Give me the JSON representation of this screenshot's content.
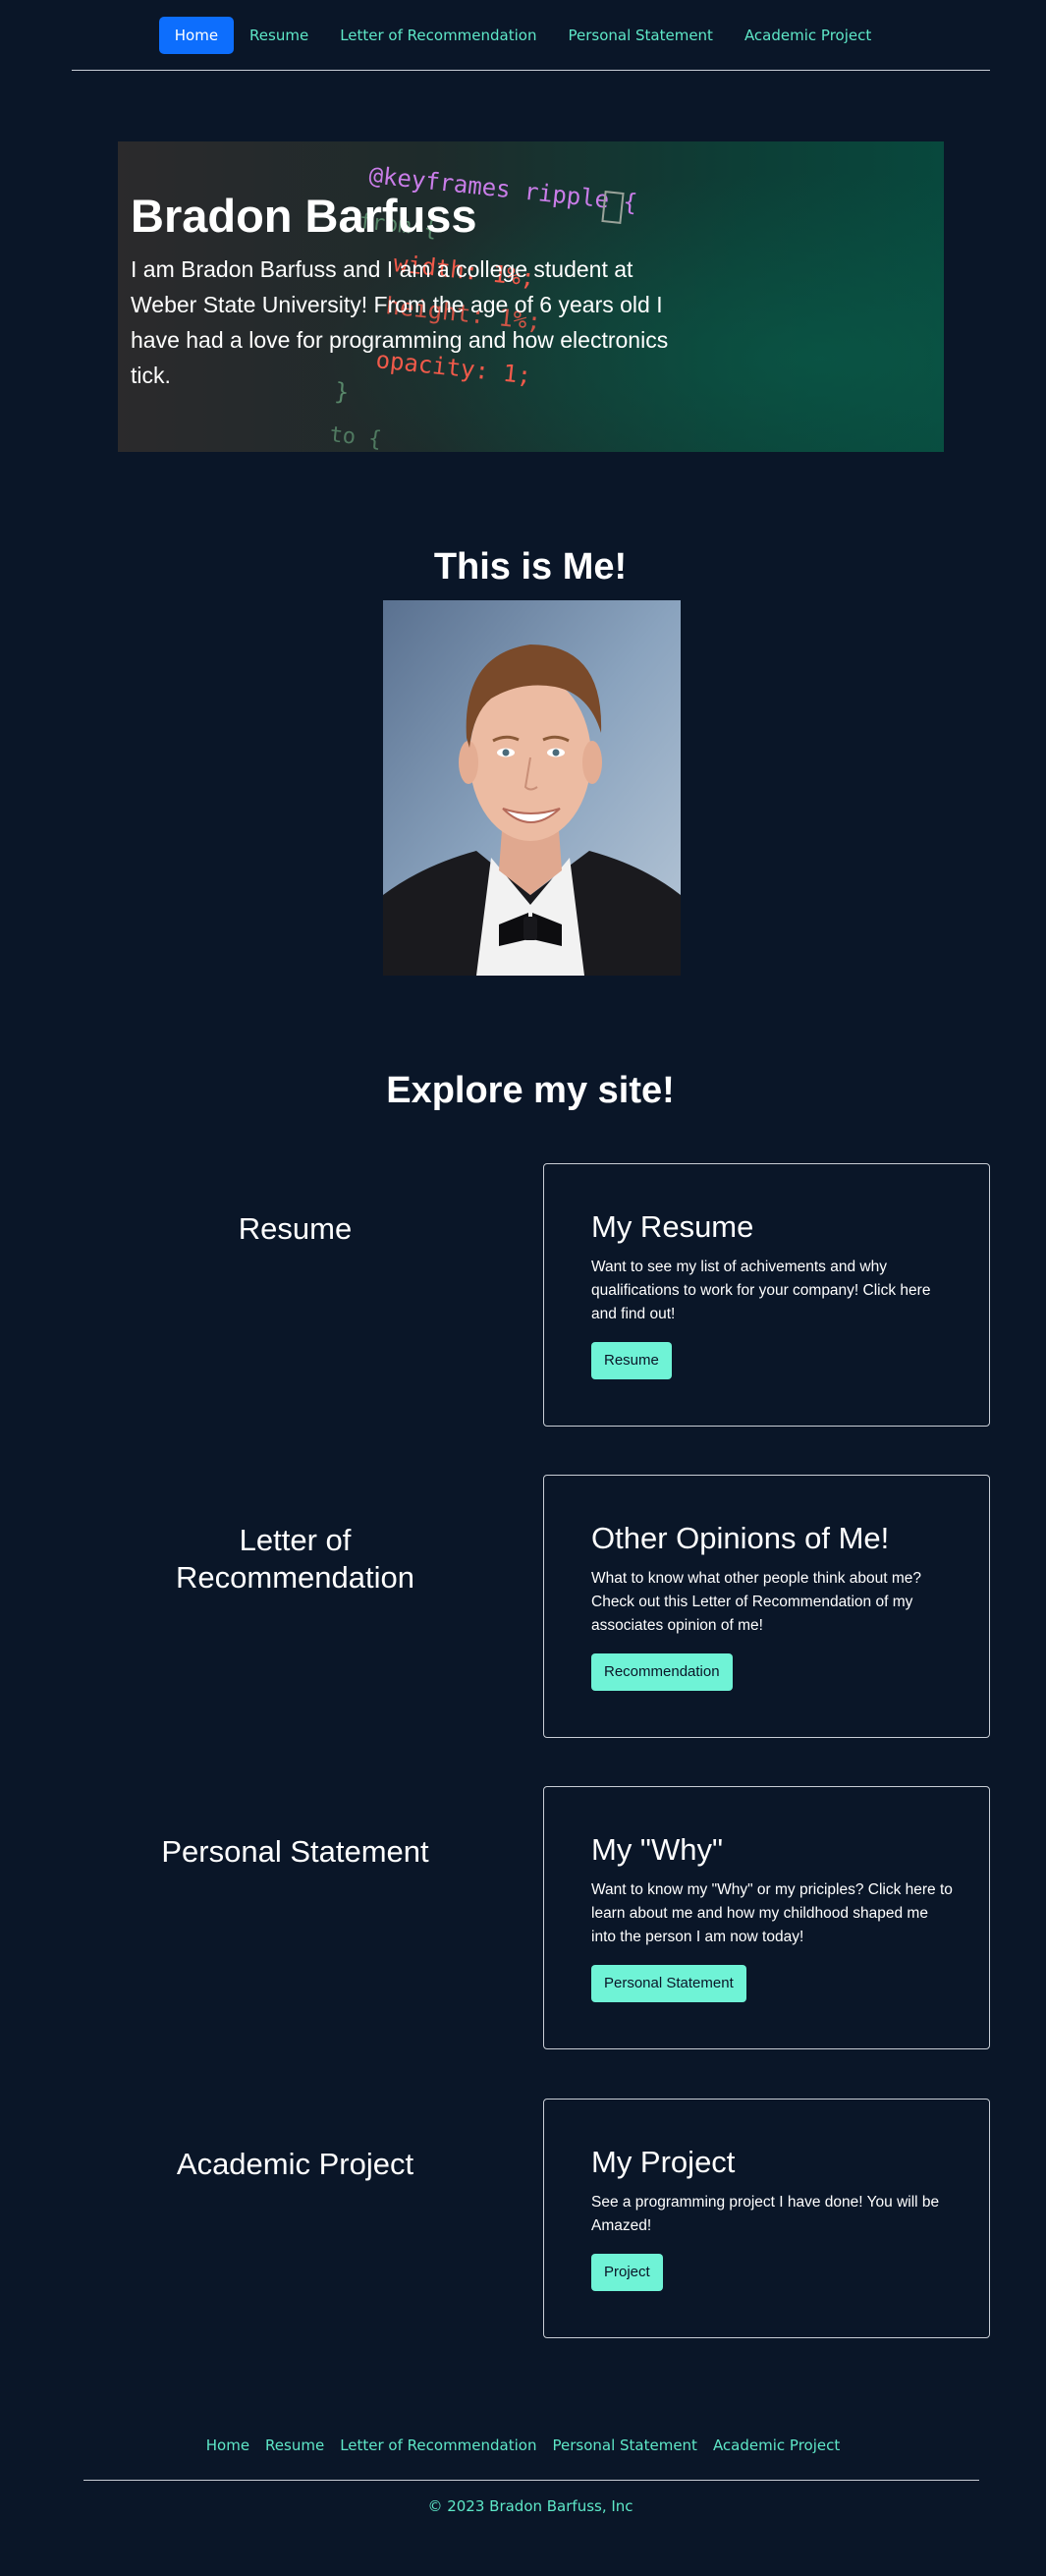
{
  "nav": {
    "items": [
      {
        "label": "Home",
        "active": true
      },
      {
        "label": "Resume",
        "active": false
      },
      {
        "label": "Letter of Recommendation",
        "active": false
      },
      {
        "label": "Personal Statement",
        "active": false
      },
      {
        "label": "Academic Project",
        "active": false
      }
    ]
  },
  "hero": {
    "title": "Bradon Barfuss",
    "text": "I am Bradon Barfuss and I am a college student at Weber State University! From the age of 6 years old I have had a love for programming and how electronics tick.",
    "code_lines": [
      "@keyframes ripple {",
      "from {",
      "width: 1%;",
      "height: 1%;",
      "opacity: 1;",
      "}",
      "to {"
    ]
  },
  "about": {
    "title": "This is Me!"
  },
  "explore": {
    "title": "Explore my site!",
    "sections": [
      {
        "label": "Resume",
        "card_title": "My Resume",
        "card_text": "Want to see my list of achivements and why qualifications to work for your company! Click here and find out!",
        "button": "Resume"
      },
      {
        "label": "Letter of Recommendation",
        "card_title": "Other Opinions of Me!",
        "card_text": "What to know what other people think about me? Check out this Letter of Recommendation of my associates opinion of me!",
        "button": "Recommendation"
      },
      {
        "label": "Personal Statement",
        "card_title": "My \"Why\"",
        "card_text": "Want to know my \"Why\" or my priciples? Click here to learn about me and how my childhood shaped me into the person I am now today!",
        "button": "Personal Statement"
      },
      {
        "label": "Academic Project",
        "card_title": "My Project",
        "card_text": "See a programming project I have done! You will be Amazed!",
        "button": "Project"
      }
    ]
  },
  "footer": {
    "items": [
      "Home",
      "Resume",
      "Letter of Recommendation",
      "Personal Statement",
      "Academic Project"
    ],
    "copyright": "© 2023 Bradon Barfuss, Inc"
  },
  "colors": {
    "background": "#0a1628",
    "accent": "#5ee8c8",
    "button": "#6ff3d6",
    "active_nav": "#0d6efd"
  }
}
